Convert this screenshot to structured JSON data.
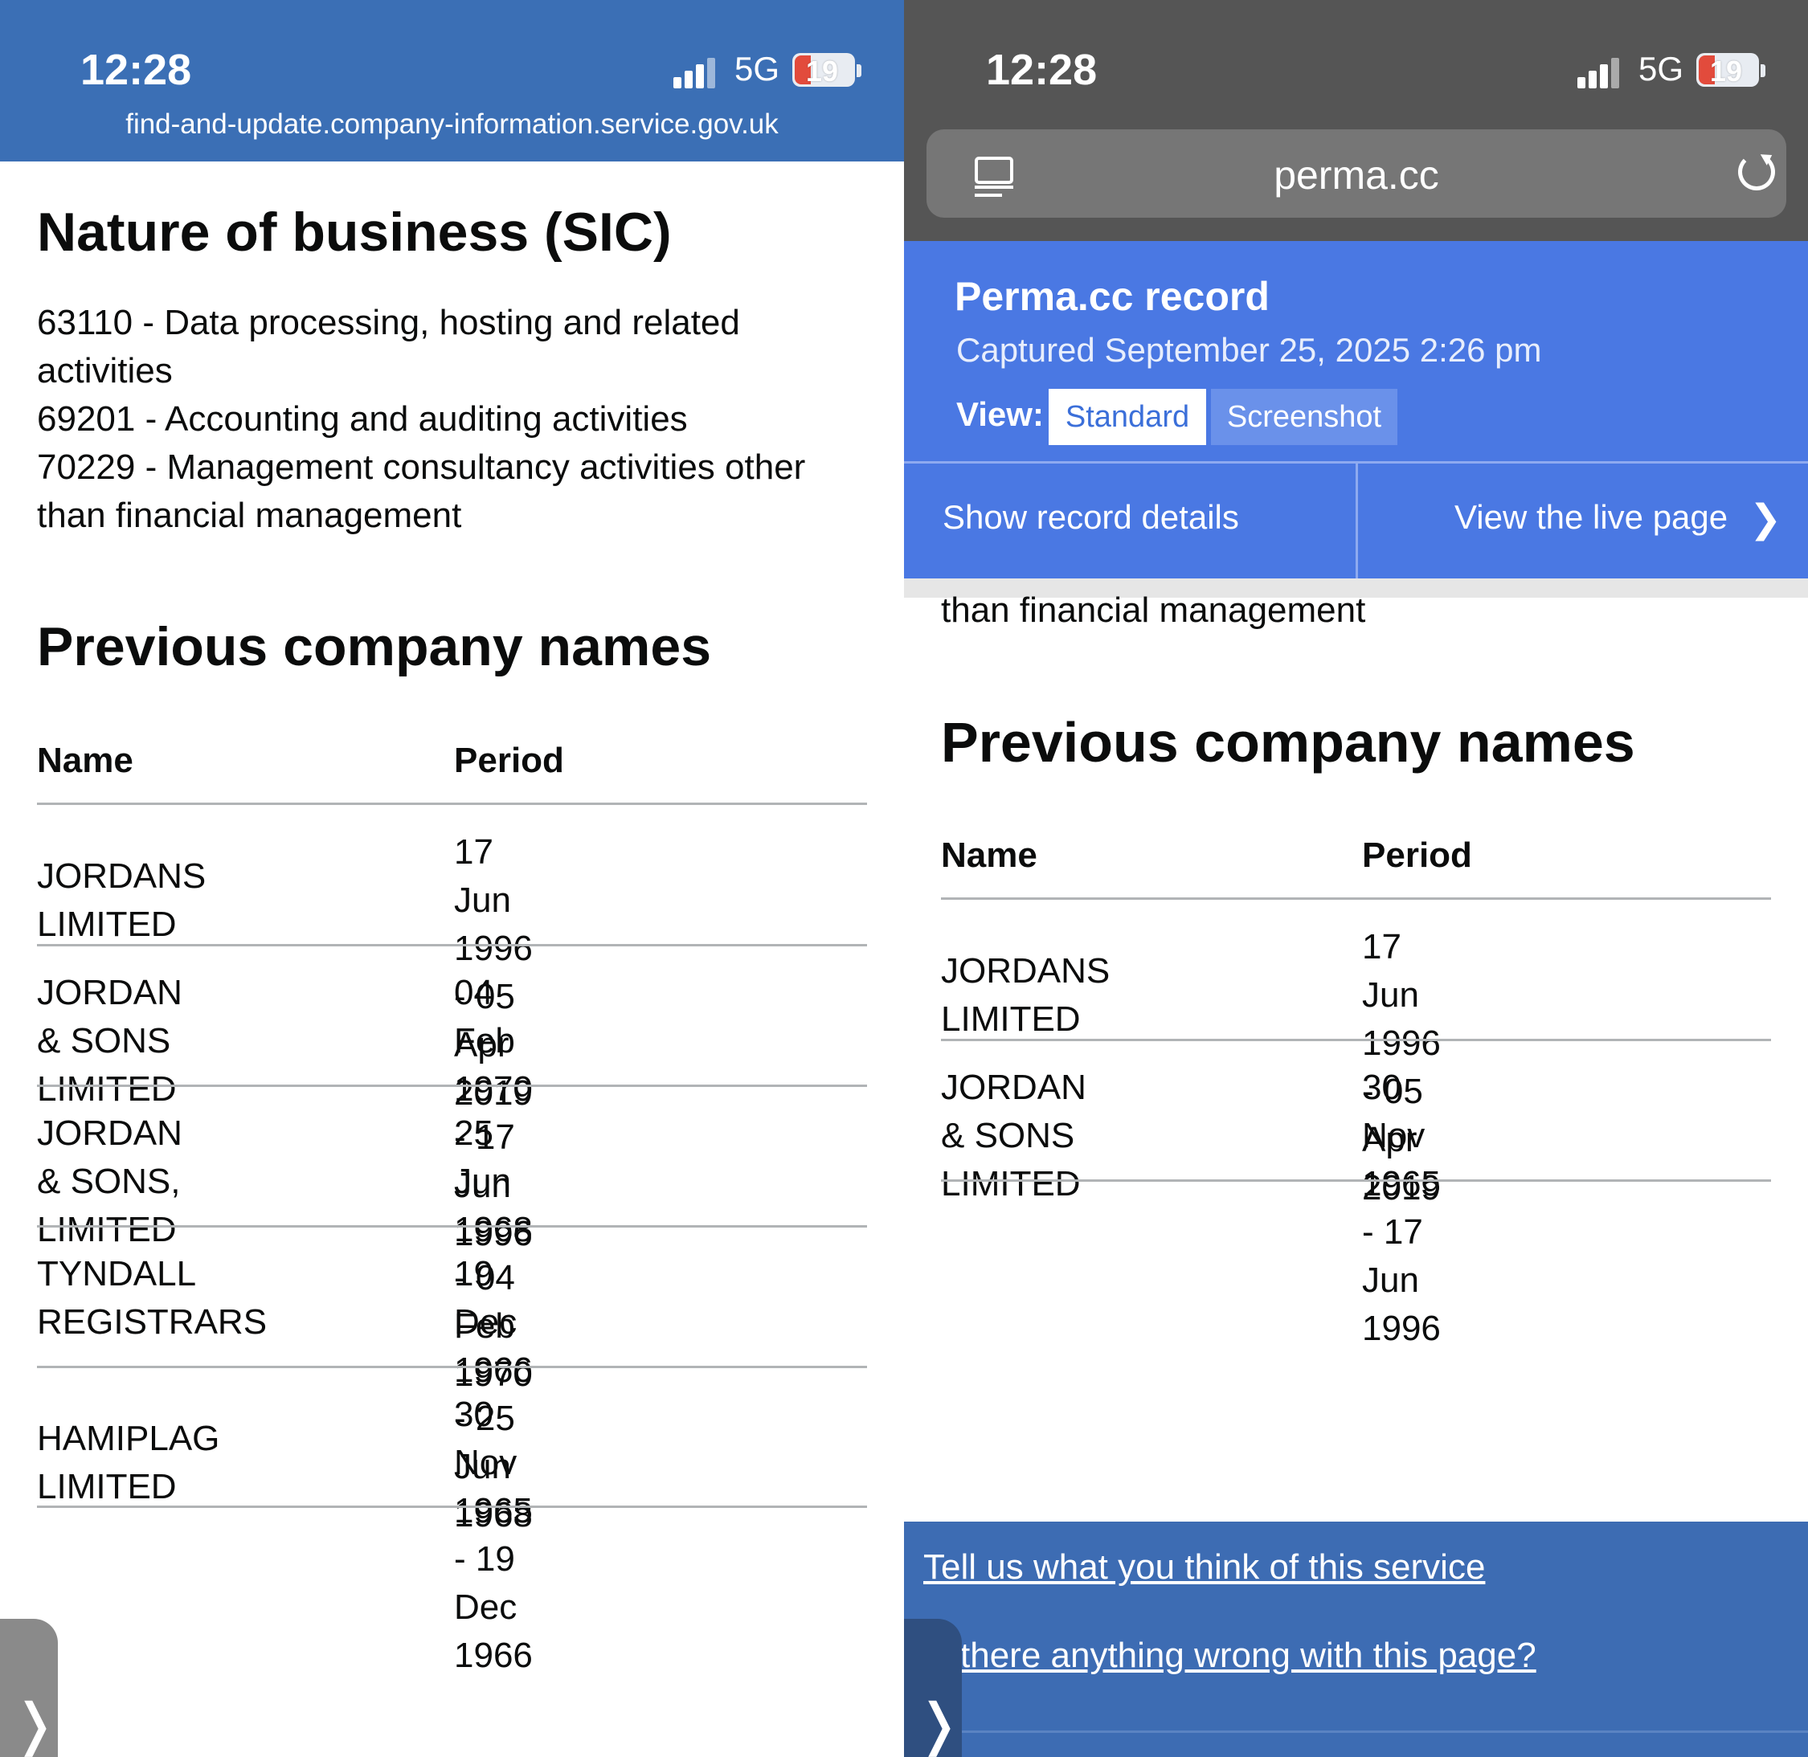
{
  "left": {
    "status": {
      "time": "12:28",
      "network": "5G",
      "battery": "19"
    },
    "url": "find-and-update.company-information.service.gov.uk",
    "sic_heading": "Nature of business (SIC)",
    "sic_lines": [
      "63110 - Data processing, hosting and related",
      "activities",
      "69201 - Accounting and auditing activities",
      "70229 - Management consultancy activities other",
      "than financial management"
    ],
    "prev_heading": "Previous company names",
    "col_name": "Name",
    "col_period": "Period",
    "rows": [
      {
        "name": [
          "JORDANS LIMITED"
        ],
        "period": [
          "17 Jun 1996 - 05 Apr",
          "2019"
        ]
      },
      {
        "name": [
          "JORDAN & SONS",
          "LIMITED"
        ],
        "period": [
          "04 Feb 1970 - 17 Jun",
          "1996"
        ]
      },
      {
        "name": [
          "JORDAN & SONS,",
          "LIMITED"
        ],
        "period": [
          "25 Jun 1968 - 04 Feb",
          "1970"
        ]
      },
      {
        "name": [
          "TYNDALL",
          "REGISTRARS"
        ],
        "period": [
          "19 Dec 1966 - 25 Jun",
          "1968"
        ]
      },
      {
        "name": [
          "HAMIPLAG LIMITED"
        ],
        "period": [
          "30 Nov 1965 - 19 Dec",
          "1966"
        ]
      }
    ],
    "pull_tab": "❭"
  },
  "right": {
    "status": {
      "time": "12:28",
      "network": "5G",
      "battery": "19"
    },
    "address": "perma.cc",
    "perma_title": "Perma.cc record",
    "captured": "Captured September 25, 2025 2:26 pm",
    "view_label": "View:",
    "view_standard": "Standard",
    "view_screenshot": "Screenshot",
    "show_details": "Show record details",
    "view_live": "View the live page",
    "chevron": "❯",
    "cut_text": "than financial management",
    "prev_heading": "Previous company names",
    "col_name": "Name",
    "col_period": "Period",
    "rows": [
      {
        "name": [
          "JORDANS LIMITED"
        ],
        "period": [
          "17 Jun 1996 - 05 Apr",
          "2019"
        ]
      },
      {
        "name": [
          "JORDAN & SONS",
          "LIMITED"
        ],
        "period": [
          "30 Nov 1965 - 17 Jun",
          "1996"
        ]
      }
    ],
    "footer_link1": "Tell us what you think of this service",
    "footer_link2": "there anything wrong with this page?",
    "pull_tab": "❭"
  },
  "colors": {
    "gov_blue": "#3b6fb5",
    "perma_blue": "#4a78e3",
    "dark_status": "#555555",
    "rule_grey": "#b1b4b6"
  }
}
